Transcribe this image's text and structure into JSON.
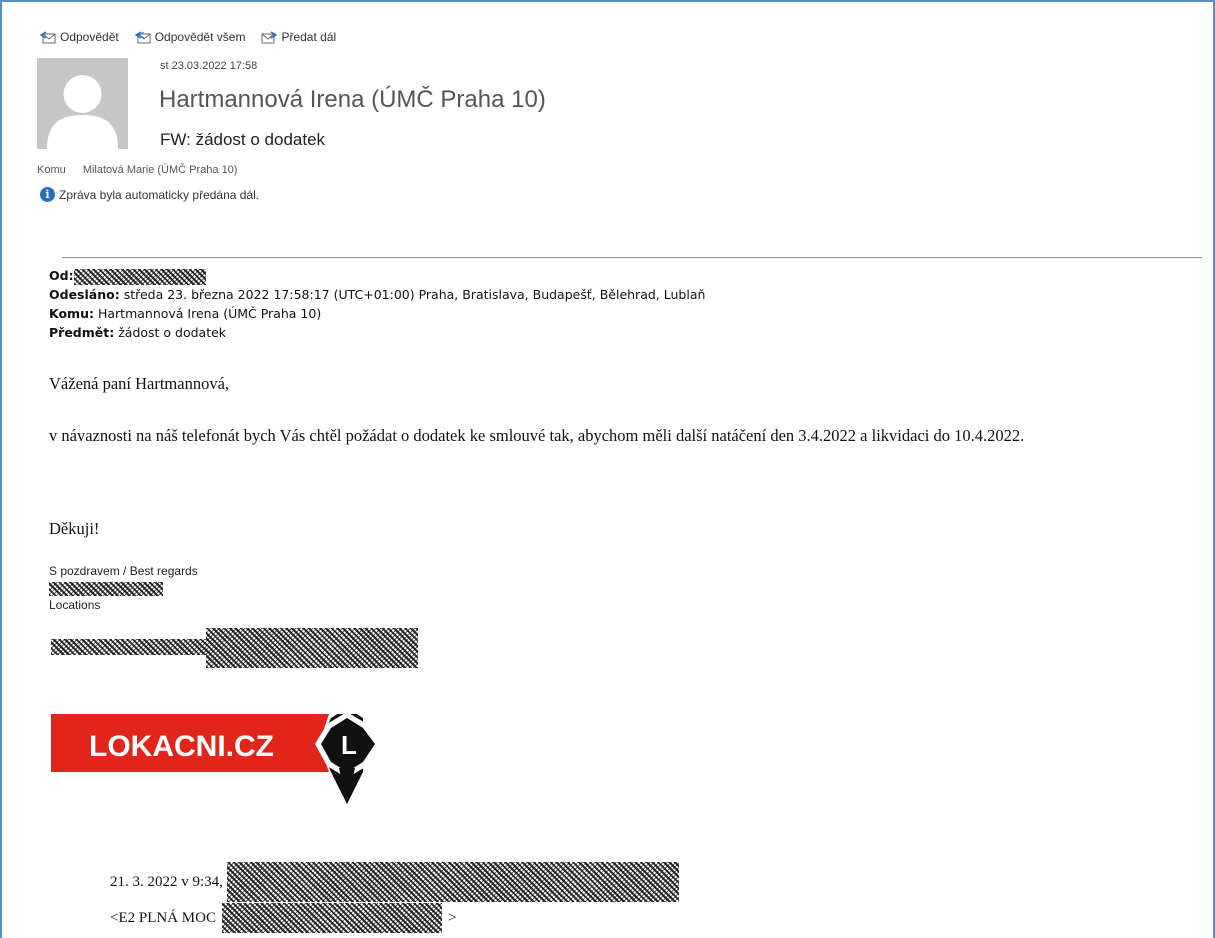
{
  "toolbar": {
    "reply": "Odpovědět",
    "reply_all": "Odpovědět všem",
    "forward": "Předat dál"
  },
  "header": {
    "date": "st 23.03.2022 17:58",
    "sender": "Hartmannová Irena (ÚMČ Praha 10)",
    "subject": "FW: žádost o dodatek",
    "to_label": "Komu",
    "to_value": "Milatová Marie (ÚMČ Praha 10)",
    "info": "Zpráva byla automaticky předána dál."
  },
  "forwarded": {
    "from_label": "Od:",
    "sent_label": "Odesláno:",
    "sent_value": "středa 23. března 2022 17:58:17 (UTC+01:00) Praha, Bratislava, Budapešť, Bělehrad, Lublaň",
    "to_label": "Komu:",
    "to_value": "Hartmannová Irena (ÚMČ Praha 10)",
    "subject_label": "Předmět:",
    "subject_value": "žádost o dodatek"
  },
  "body": {
    "greeting": "Vážená paní Hartmannová,",
    "paragraph": "v návaznosti na náš telefonát bych Vás chtěl požádat o dodatek ke smlouvé tak, abychom měli další natáčení den 3.4.2022 a likvidaci do 10.4.2022.",
    "thanks": "Děkuji!",
    "sig_line1": "S pozdravem / Best regards",
    "sig_line2": "Locations"
  },
  "logo": {
    "text": "LOKACNI.CZ",
    "mark": "L",
    "color": "#e1251b"
  },
  "quote": {
    "line1_prefix": "21. 3. 2022 v 9:34,",
    "line2_prefix": "<E2  PLNÁ MOC",
    "line2_suffix": ">"
  }
}
